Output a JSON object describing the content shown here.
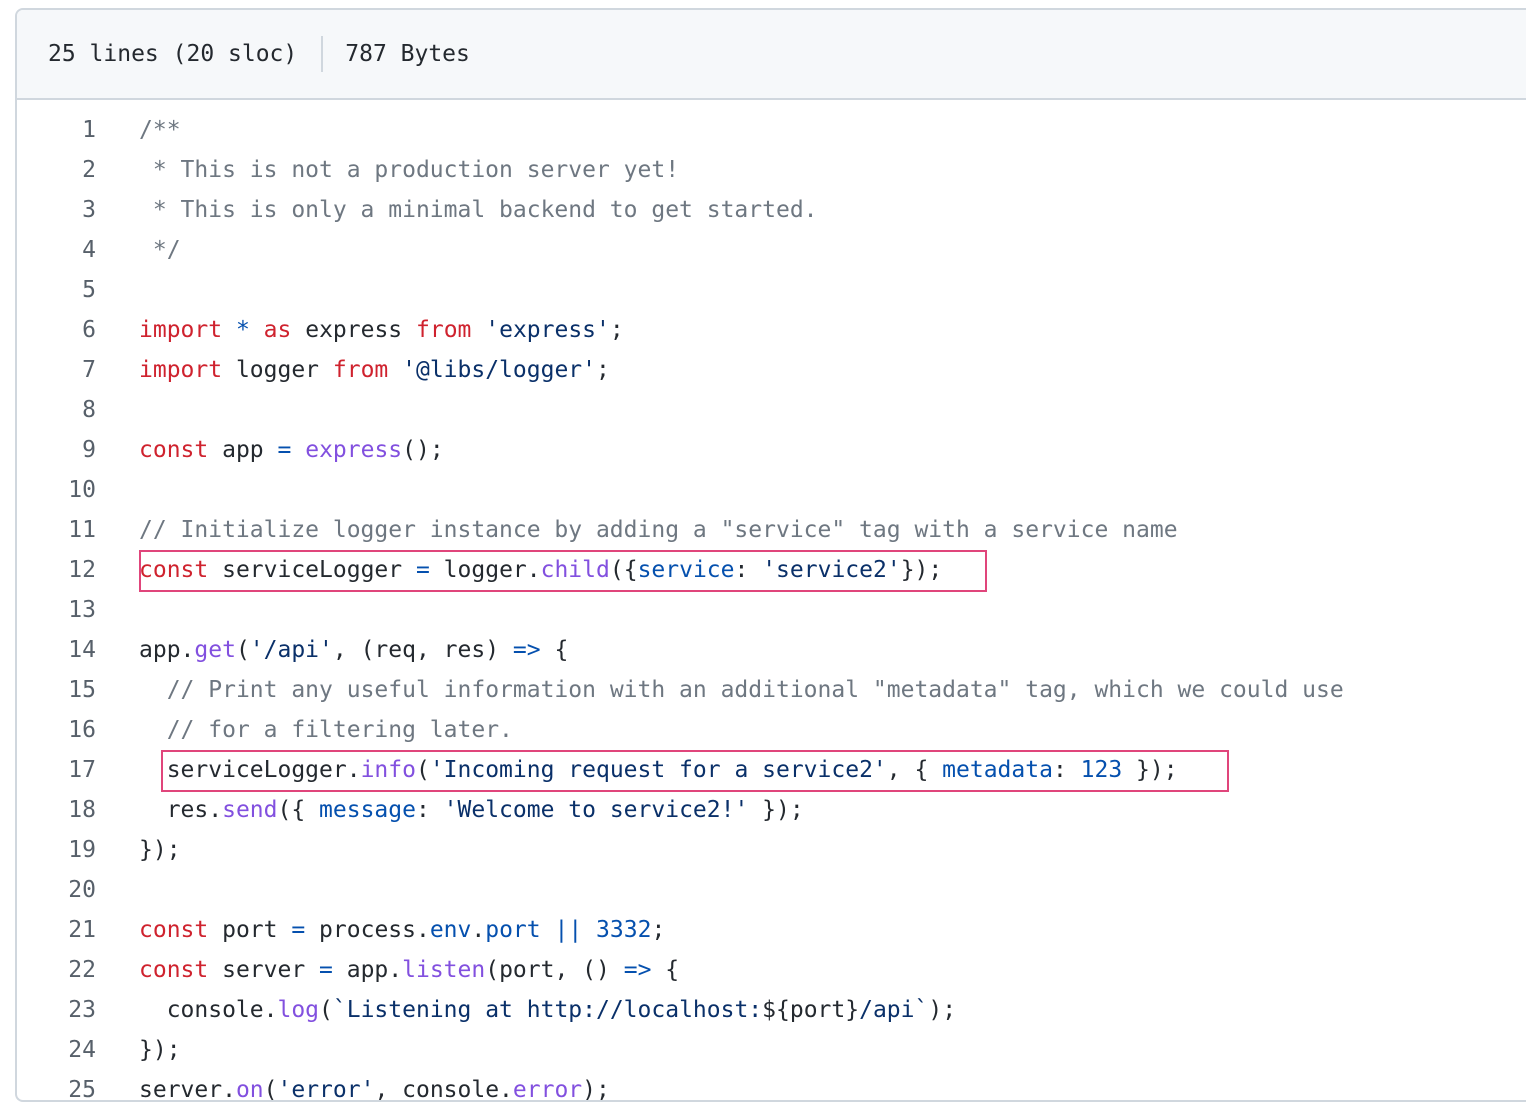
{
  "header": {
    "lines_info": "25 lines (20 sloc)",
    "size": "787 Bytes"
  },
  "colors": {
    "comment": "#6e7781",
    "keyword": "#cf222e",
    "string": "#0a3069",
    "function": "#8250df",
    "property": "#0550ae",
    "text": "#24292f",
    "highlight_box": "#e0457b"
  },
  "code": {
    "lines": [
      {
        "num": "1",
        "tokens": [
          {
            "t": "c",
            "v": "/**"
          }
        ]
      },
      {
        "num": "2",
        "tokens": [
          {
            "t": "c",
            "v": " * This is not a production server yet!"
          }
        ]
      },
      {
        "num": "3",
        "tokens": [
          {
            "t": "c",
            "v": " * This is only a minimal backend to get started."
          }
        ]
      },
      {
        "num": "4",
        "tokens": [
          {
            "t": "c",
            "v": " */"
          }
        ]
      },
      {
        "num": "5",
        "tokens": []
      },
      {
        "num": "6",
        "tokens": [
          {
            "t": "k",
            "v": "import"
          },
          {
            "t": "",
            "v": " "
          },
          {
            "t": "v",
            "v": "*"
          },
          {
            "t": "",
            "v": " "
          },
          {
            "t": "k",
            "v": "as"
          },
          {
            "t": "",
            "v": " express "
          },
          {
            "t": "k",
            "v": "from"
          },
          {
            "t": "",
            "v": " "
          },
          {
            "t": "s",
            "v": "'express'"
          },
          {
            "t": "",
            "v": ";"
          }
        ]
      },
      {
        "num": "7",
        "tokens": [
          {
            "t": "k",
            "v": "import"
          },
          {
            "t": "",
            "v": " logger "
          },
          {
            "t": "k",
            "v": "from"
          },
          {
            "t": "",
            "v": " "
          },
          {
            "t": "s",
            "v": "'@libs/logger'"
          },
          {
            "t": "",
            "v": ";"
          }
        ]
      },
      {
        "num": "8",
        "tokens": []
      },
      {
        "num": "9",
        "tokens": [
          {
            "t": "k",
            "v": "const"
          },
          {
            "t": "",
            "v": " app "
          },
          {
            "t": "v",
            "v": "="
          },
          {
            "t": "",
            "v": " "
          },
          {
            "t": "f",
            "v": "express"
          },
          {
            "t": "",
            "v": "();"
          }
        ]
      },
      {
        "num": "10",
        "tokens": []
      },
      {
        "num": "11",
        "tokens": [
          {
            "t": "c",
            "v": "// Initialize logger instance by adding a \"service\" tag with a service name"
          }
        ]
      },
      {
        "num": "12",
        "tokens": [
          {
            "t": "k",
            "v": "const"
          },
          {
            "t": "",
            "v": " serviceLogger "
          },
          {
            "t": "v",
            "v": "="
          },
          {
            "t": "",
            "v": " logger."
          },
          {
            "t": "f",
            "v": "child"
          },
          {
            "t": "",
            "v": "({"
          },
          {
            "t": "v",
            "v": "service"
          },
          {
            "t": "",
            "v": ": "
          },
          {
            "t": "s",
            "v": "'service2'"
          },
          {
            "t": "",
            "v": "});"
          }
        ]
      },
      {
        "num": "13",
        "tokens": []
      },
      {
        "num": "14",
        "tokens": [
          {
            "t": "",
            "v": "app."
          },
          {
            "t": "f",
            "v": "get"
          },
          {
            "t": "",
            "v": "("
          },
          {
            "t": "s",
            "v": "'/api'"
          },
          {
            "t": "",
            "v": ", (req, res) "
          },
          {
            "t": "v",
            "v": "=>"
          },
          {
            "t": "",
            "v": " {"
          }
        ]
      },
      {
        "num": "15",
        "tokens": [
          {
            "t": "",
            "v": "  "
          },
          {
            "t": "c",
            "v": "// Print any useful information with an additional \"metadata\" tag, which we could use"
          }
        ]
      },
      {
        "num": "16",
        "tokens": [
          {
            "t": "",
            "v": "  "
          },
          {
            "t": "c",
            "v": "// for a filtering later."
          }
        ]
      },
      {
        "num": "17",
        "tokens": [
          {
            "t": "",
            "v": "  serviceLogger."
          },
          {
            "t": "f",
            "v": "info"
          },
          {
            "t": "",
            "v": "("
          },
          {
            "t": "s",
            "v": "'Incoming request for a service2'"
          },
          {
            "t": "",
            "v": ", { "
          },
          {
            "t": "v",
            "v": "metadata"
          },
          {
            "t": "",
            "v": ": "
          },
          {
            "t": "v",
            "v": "123"
          },
          {
            "t": "",
            "v": " });"
          }
        ]
      },
      {
        "num": "18",
        "tokens": [
          {
            "t": "",
            "v": "  res."
          },
          {
            "t": "f",
            "v": "send"
          },
          {
            "t": "",
            "v": "({ "
          },
          {
            "t": "v",
            "v": "message"
          },
          {
            "t": "",
            "v": ": "
          },
          {
            "t": "s",
            "v": "'Welcome to service2!'"
          },
          {
            "t": "",
            "v": " });"
          }
        ]
      },
      {
        "num": "19",
        "tokens": [
          {
            "t": "",
            "v": "});"
          }
        ]
      },
      {
        "num": "20",
        "tokens": []
      },
      {
        "num": "21",
        "tokens": [
          {
            "t": "k",
            "v": "const"
          },
          {
            "t": "",
            "v": " port "
          },
          {
            "t": "v",
            "v": "="
          },
          {
            "t": "",
            "v": " process."
          },
          {
            "t": "v",
            "v": "env"
          },
          {
            "t": "",
            "v": "."
          },
          {
            "t": "v",
            "v": "port"
          },
          {
            "t": "",
            "v": " "
          },
          {
            "t": "v",
            "v": "||"
          },
          {
            "t": "",
            "v": " "
          },
          {
            "t": "v",
            "v": "3332"
          },
          {
            "t": "",
            "v": ";"
          }
        ]
      },
      {
        "num": "22",
        "tokens": [
          {
            "t": "k",
            "v": "const"
          },
          {
            "t": "",
            "v": " server "
          },
          {
            "t": "v",
            "v": "="
          },
          {
            "t": "",
            "v": " app."
          },
          {
            "t": "f",
            "v": "listen"
          },
          {
            "t": "",
            "v": "(port, () "
          },
          {
            "t": "v",
            "v": "=>"
          },
          {
            "t": "",
            "v": " {"
          }
        ]
      },
      {
        "num": "23",
        "tokens": [
          {
            "t": "",
            "v": "  console."
          },
          {
            "t": "f",
            "v": "log"
          },
          {
            "t": "",
            "v": "("
          },
          {
            "t": "s",
            "v": "`Listening at http://localhost:"
          },
          {
            "t": "",
            "v": "${port}"
          },
          {
            "t": "s",
            "v": "/api`"
          },
          {
            "t": "",
            "v": ");"
          }
        ]
      },
      {
        "num": "24",
        "tokens": [
          {
            "t": "",
            "v": "});"
          }
        ]
      },
      {
        "num": "25",
        "tokens": [
          {
            "t": "",
            "v": "server."
          },
          {
            "t": "f",
            "v": "on"
          },
          {
            "t": "",
            "v": "("
          },
          {
            "t": "s",
            "v": "'error'"
          },
          {
            "t": "",
            "v": ", console."
          },
          {
            "t": "f",
            "v": "error"
          },
          {
            "t": "",
            "v": ");"
          }
        ]
      }
    ]
  }
}
